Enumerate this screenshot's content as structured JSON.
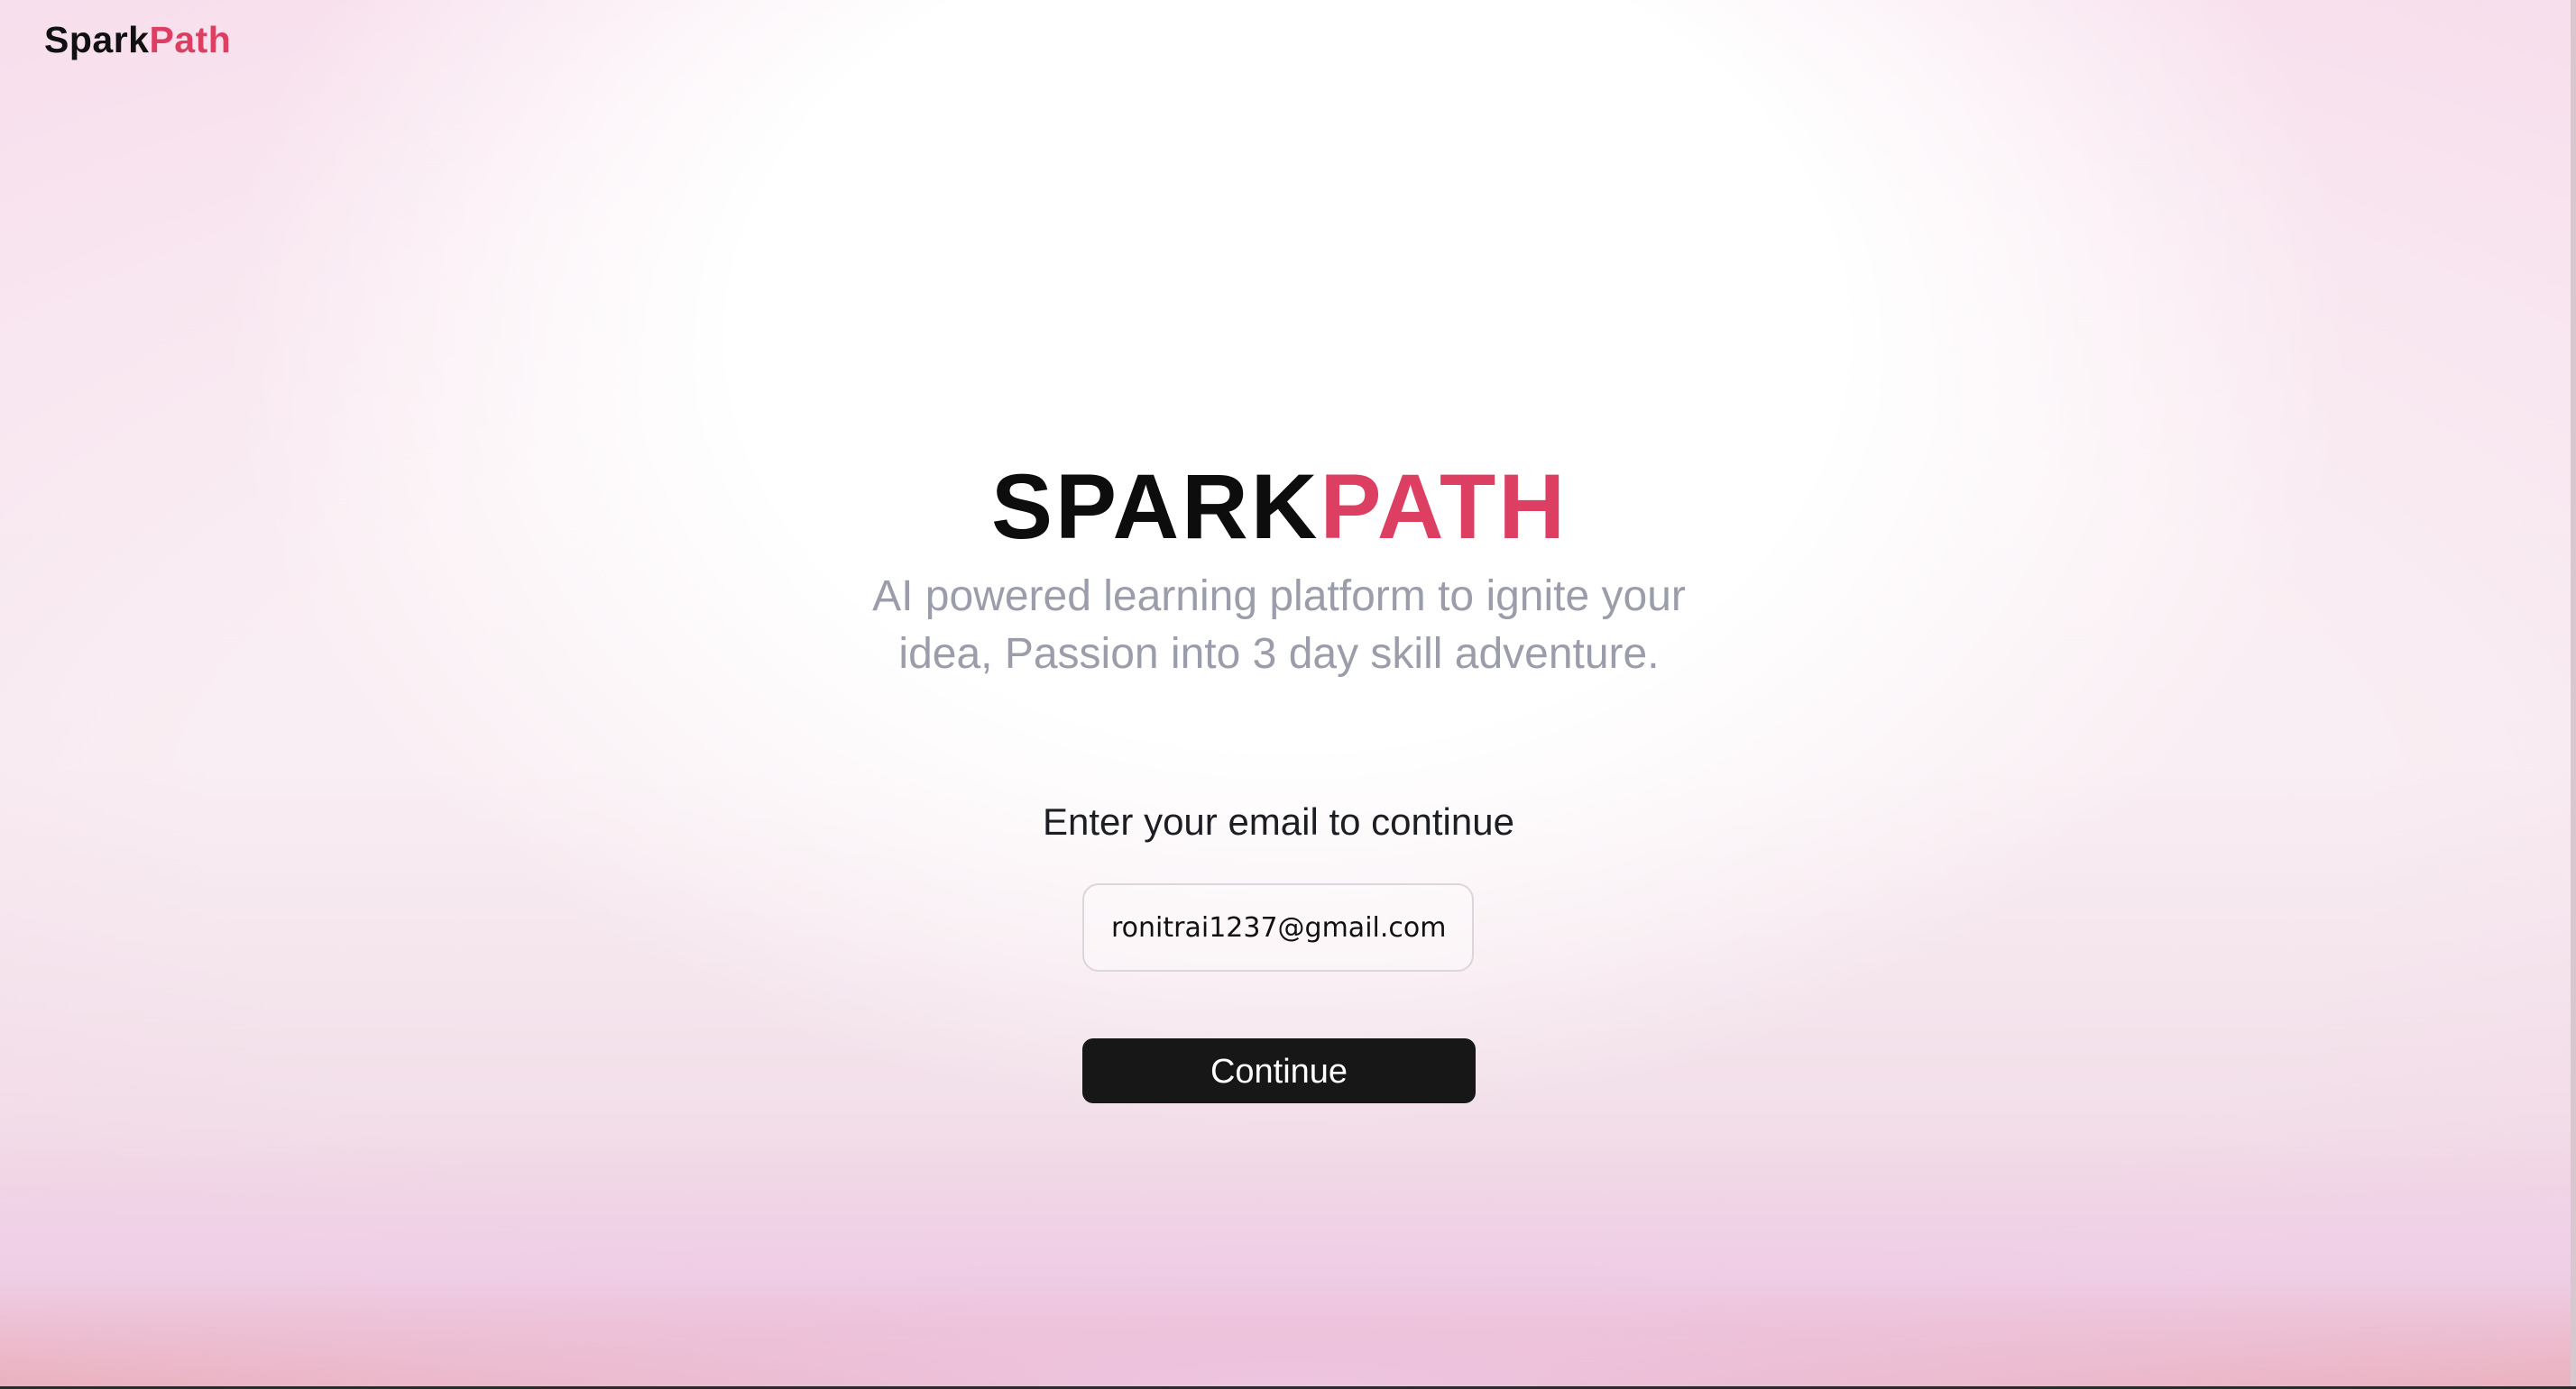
{
  "header": {
    "brand_part1": "Spark",
    "brand_part2": "Path"
  },
  "hero": {
    "title_part1": "SPARK",
    "title_part2": "PATH",
    "subtitle": "AI powered learning platform to ignite your idea, Passion into 3 day skill adventure."
  },
  "form": {
    "label": "Enter your email to continue",
    "email_value": "ronitrai1237@gmail.com",
    "continue_label": "Continue"
  },
  "colors": {
    "accent": "#dd3f62",
    "button_bg": "#171717",
    "subtitle_text": "#9b9daa"
  }
}
